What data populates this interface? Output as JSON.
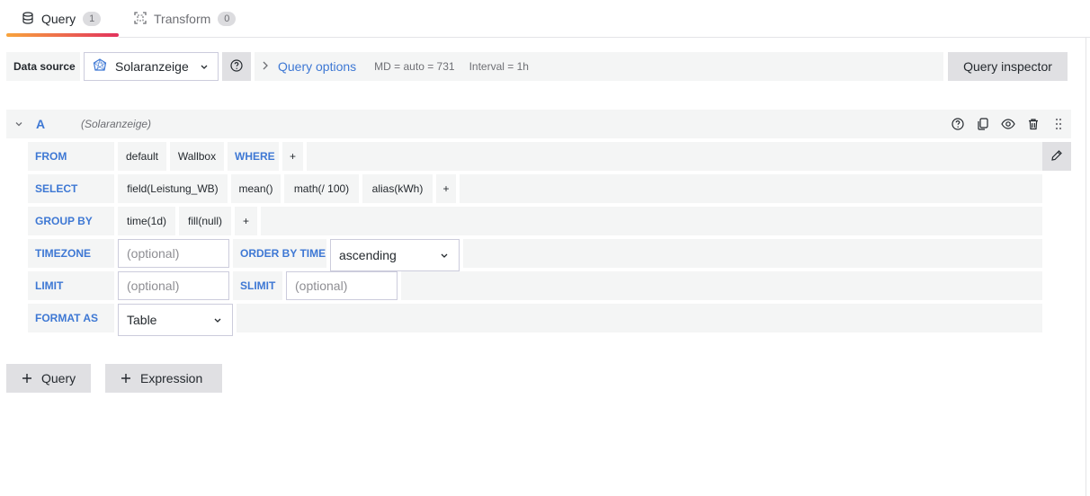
{
  "tabs": [
    {
      "label": "Query",
      "count": "1",
      "icon": "database-icon",
      "active": true
    },
    {
      "label": "Transform",
      "count": "0",
      "icon": "transform-icon",
      "active": false
    }
  ],
  "datasource": {
    "label": "Data source",
    "name": "Solaranzeige",
    "query_options_label": "Query options",
    "md": "MD = auto = 731",
    "interval": "Interval = 1h",
    "inspector_label": "Query inspector"
  },
  "query": {
    "ref_id": "A",
    "datasource_name": "(Solaranzeige)",
    "from": {
      "keyword": "FROM",
      "policy": "default",
      "measurement": "Wallbox",
      "where_keyword": "WHERE",
      "add": "+"
    },
    "select": {
      "keyword": "SELECT",
      "parts": [
        "field(Leistung_WB)",
        "mean()",
        "math(/ 100)",
        "alias(kWh)"
      ],
      "add": "+"
    },
    "group_by": {
      "keyword": "GROUP BY",
      "parts": [
        "time(1d)",
        "fill(null)"
      ],
      "add": "+"
    },
    "timezone": {
      "keyword": "TIMEZONE",
      "placeholder": "(optional)",
      "order_keyword": "ORDER BY TIME",
      "order_value": "ascending"
    },
    "limit": {
      "keyword": "LIMIT",
      "placeholder": "(optional)",
      "slimit_keyword": "SLIMIT",
      "slimit_placeholder": "(optional)"
    },
    "format": {
      "keyword": "FORMAT AS",
      "value": "Table"
    }
  },
  "actions": {
    "add_query": "Query",
    "add_expression": "Expression"
  },
  "colors": {
    "accent": "#3e78d4",
    "tab_gradient_start": "#f8a43c",
    "tab_gradient_end": "#e2325d"
  }
}
